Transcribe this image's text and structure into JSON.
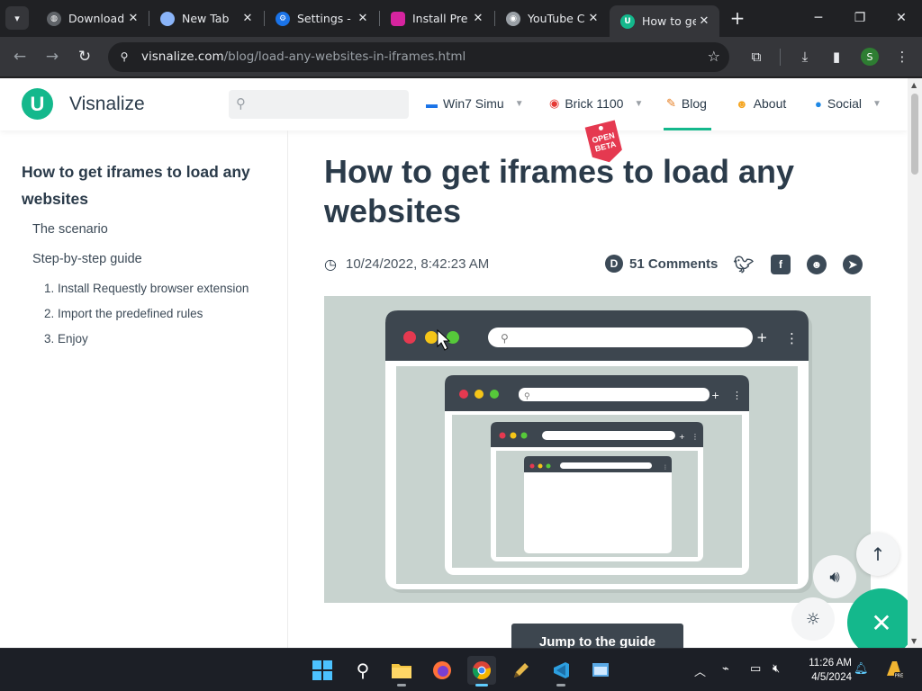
{
  "browser": {
    "tabs": [
      {
        "title": "Download",
        "favicon": "globe-icon",
        "active": false
      },
      {
        "title": "New Tab",
        "favicon": "chrome-icon",
        "active": false
      },
      {
        "title": "Settings - ",
        "favicon": "gear-icon",
        "active": false
      },
      {
        "title": "Install Pre",
        "favicon": "instagram-icon",
        "active": false
      },
      {
        "title": "YouTube C",
        "favicon": "youtube-icon",
        "active": false
      },
      {
        "title": "How to ge",
        "favicon": "visnalize-icon",
        "active": true
      }
    ],
    "url_host": "visnalize.com",
    "url_path": "/blog/load-any-websites-in-iframes.html",
    "profile_initial": "S"
  },
  "site": {
    "brand": "Visnalize",
    "logo_letter": "U",
    "search_placeholder": "",
    "nav": [
      {
        "label": "Win7 Simu",
        "icon": "monitor-icon",
        "has_caret": true
      },
      {
        "label": "Brick 1100",
        "icon": "phone-icon",
        "has_caret": true
      },
      {
        "label": "Blog",
        "icon": "pencil-icon",
        "has_caret": false,
        "active": true
      },
      {
        "label": "About",
        "icon": "person-icon",
        "has_caret": false
      },
      {
        "label": "Social",
        "icon": "globe-icon",
        "has_caret": true
      }
    ],
    "beta_tag": "OPEN BETA"
  },
  "toc": {
    "title": "How to get iframes to load any websites",
    "items": [
      "The scenario",
      "Step-by-step guide"
    ],
    "subitems": [
      "1. Install Requestly browser extension",
      "2. Import the predefined rules",
      "3. Enjoy"
    ]
  },
  "article": {
    "title": "How to get iframes to load any websites",
    "date": "10/24/2022, 8:42:23 AM",
    "comments": "51 Comments",
    "share": [
      "twitter",
      "facebook",
      "reddit",
      "telegram"
    ],
    "jump_label": "Jump to the guide"
  },
  "taskbar": {
    "time": "11:26 AM",
    "date": "4/5/2024",
    "apps": [
      "start",
      "search",
      "file-explorer",
      "firefox",
      "chrome",
      "app-6",
      "app-7",
      "app-8"
    ]
  },
  "colors": {
    "accent": "#14b88c",
    "text": "#2b3b4a",
    "chrome_bg": "#202124",
    "toolbar_bg": "#35363a"
  }
}
